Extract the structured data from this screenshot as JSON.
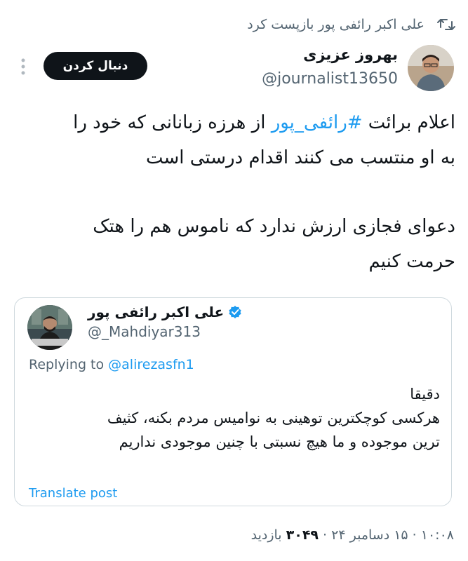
{
  "repost": {
    "text": "علی اکبر رائفی پور بازپست کرد",
    "icon": "repost-icon"
  },
  "author": {
    "name": "بهروز عزیزی",
    "handle": "@journalist13650"
  },
  "follow_button": {
    "label": "دنبال کردن"
  },
  "tweet": {
    "line1_pre": "اعلام برائت ",
    "line1_hashtag": "#رائفی_پور",
    "line1_post": " از هرزه زبانانی که خود را",
    "line2": "به او منتسب می کنند اقدام درستی است",
    "line3": "دعوای فجازی ارزش ندارد که ناموس هم را هتک",
    "line4": "حرمت کنیم"
  },
  "quoted_tweet": {
    "name": "علی اکبر رائفی پور",
    "handle": "@_Mahdiyar313",
    "replying_prefix": "Replying to ",
    "replying_to": "@alirezasfn1",
    "line1": "دقیقا",
    "line2": "هرکسی کوچکترین توهینی به نوامیس مردم بکنه، کثیف",
    "line3": "ترین موجوده و ما هیچ نسبتی  با چنین موجودی نداریم",
    "translate_label": "Translate post"
  },
  "meta": {
    "time": "۱۰:۰۸",
    "separator": " · ",
    "date": "۱۵ دسامبر ۲۴",
    "views": "۳۰۴۹",
    "views_label": " بازدید"
  },
  "colors": {
    "accent": "#1d9bf0",
    "text": "#0f1419",
    "muted": "#536471",
    "border": "#cfd9de"
  }
}
